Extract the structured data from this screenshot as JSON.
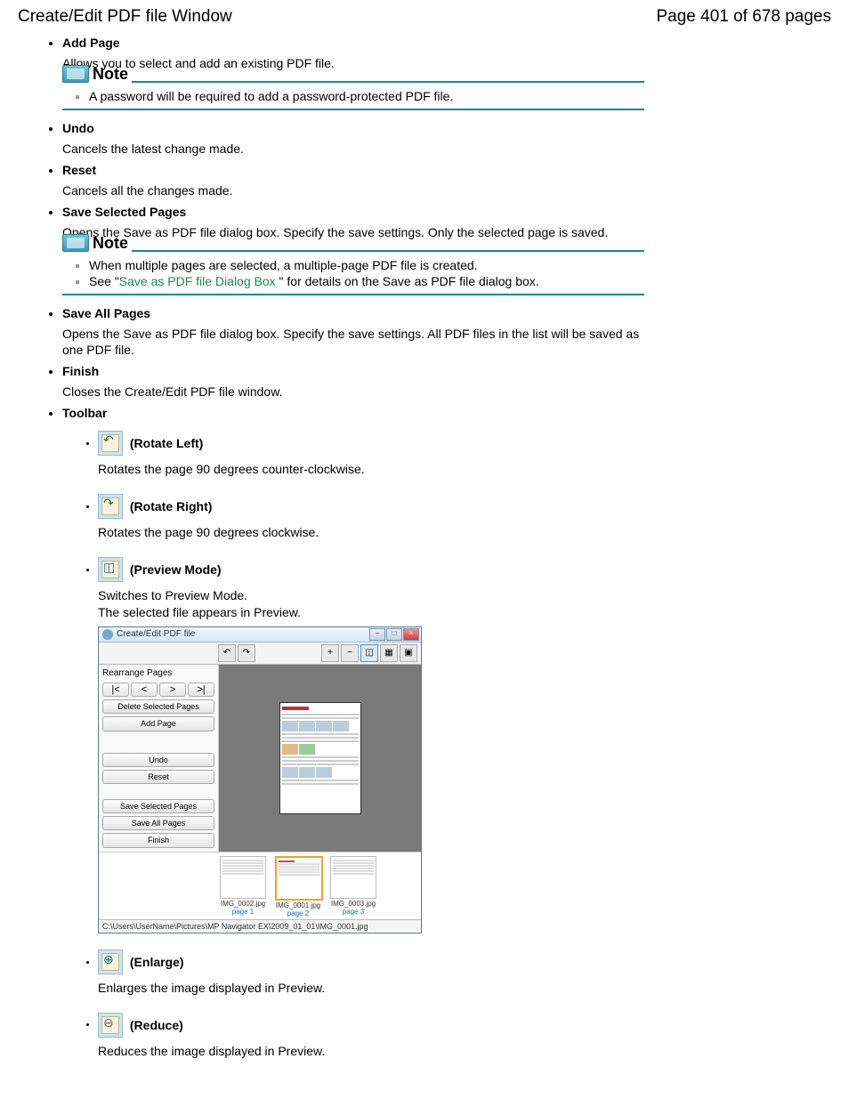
{
  "header": {
    "title": "Create/Edit PDF file Window",
    "page": "Page 401 of 678 pages"
  },
  "items": {
    "add_page": {
      "term": "Add Page",
      "desc": "Allows you to select and add an existing PDF file."
    },
    "undo": {
      "term": "Undo",
      "desc": "Cancels the latest change made."
    },
    "reset": {
      "term": "Reset",
      "desc": "Cancels all the changes made."
    },
    "save_selected": {
      "term": "Save Selected Pages",
      "desc": "Opens the Save as PDF file dialog box. Specify the save settings. Only the selected page is saved."
    },
    "save_all": {
      "term": "Save All Pages",
      "desc": "Opens the Save as PDF file dialog box. Specify the save settings. All PDF files in the list will be saved as one PDF file."
    },
    "finish": {
      "term": "Finish",
      "desc": "Closes the Create/Edit PDF file window."
    },
    "toolbar": {
      "term": "Toolbar"
    }
  },
  "notes": {
    "title": "Note",
    "note1": "A password will be required to add a password-protected PDF file.",
    "note2a": "When multiple pages are selected, a multiple-page PDF file is created.",
    "note2b_pre": "See \"",
    "note2b_link": "Save as PDF file Dialog Box ",
    "note2b_post": "\" for details on the Save as PDF file dialog box."
  },
  "toolbar_items": {
    "rotate_left": {
      "label": " (Rotate Left)",
      "desc": "Rotates the page 90 degrees counter-clockwise."
    },
    "rotate_right": {
      "label": " (Rotate Right)",
      "desc": "Rotates the page 90 degrees clockwise."
    },
    "preview": {
      "label": " (Preview Mode)",
      "desc1": "Switches to Preview Mode.",
      "desc2": "The selected file appears in Preview."
    },
    "enlarge": {
      "label": " (Enlarge)",
      "desc": "Enlarges the image displayed in Preview."
    },
    "reduce": {
      "label": " (Reduce)",
      "desc": "Reduces the image displayed in Preview."
    }
  },
  "app": {
    "title": "Create/Edit PDF file",
    "side": {
      "heading": "Rearrange Pages",
      "first": "|<",
      "prev": "<",
      "next": ">",
      "last": ">|",
      "delete": "Delete Selected Pages",
      "add": "Add Page",
      "undo": "Undo",
      "reset": "Reset",
      "save_sel": "Save Selected Pages",
      "save_all": "Save All Pages",
      "finish": "Finish"
    },
    "thumbs": [
      {
        "fn": "IMG_0002.jpg",
        "pg": "page 1"
      },
      {
        "fn": "IMG_0001.jpg",
        "pg": "page 2"
      },
      {
        "fn": "IMG_0003.jpg",
        "pg": "page 3"
      }
    ],
    "status": "C:\\Users\\UserName\\Pictures\\MP Navigator EX\\2009_01_01\\IMG_0001.jpg"
  }
}
